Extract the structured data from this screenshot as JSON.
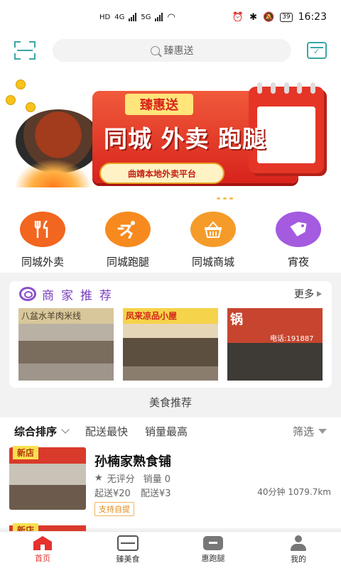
{
  "status_bar": {
    "hd_labels": [
      "HD",
      "HD"
    ],
    "network_labels": [
      "4G",
      "5G"
    ],
    "battery": "39",
    "time": "16:23"
  },
  "header": {
    "search_placeholder": "臻惠送",
    "scan_icon": "scan-icon",
    "calendar_icon": "calendar-check-icon",
    "accent_color": "#3aa6a6"
  },
  "banner": {
    "tag": "臻惠送",
    "title": "同城 外卖 跑腿",
    "subtitle": "曲靖本地外卖平台"
  },
  "categories": [
    {
      "label": "同城外卖",
      "icon": "fork-knife-icon",
      "color": "#f2661f"
    },
    {
      "label": "同城跑腿",
      "icon": "runner-icon",
      "color": "#f78a1f"
    },
    {
      "label": "同城商城",
      "icon": "basket-icon",
      "color": "#f59b2a"
    },
    {
      "label": "宵夜",
      "icon": "tag-icon",
      "color": "#a45be0"
    }
  ],
  "merchants": {
    "title": "商家推荐",
    "more": "更多",
    "shops": [
      {
        "sign": "八盆水羊肉米线",
        "sign_color": "#d8c79a"
      },
      {
        "sign": "凤来凉品小屋",
        "sign_color": "#f5d34a"
      },
      {
        "sign": "锅",
        "sign_color": "#c7452f",
        "phone": "电话:191887"
      }
    ]
  },
  "section_label": "美食推荐",
  "sort_bar": {
    "active": "综合排序",
    "options": [
      "配送最快",
      "销量最高"
    ],
    "filter": "筛选"
  },
  "stores": [
    {
      "badge": "新店",
      "name": "孙楠家熟食铺",
      "rating": "无评分",
      "sales": "销量 0",
      "min_order": "起送¥20",
      "delivery_fee": "配送¥3",
      "distance": "40分钟 1079.7km",
      "tag": "支持自提"
    },
    {
      "badge": "新店"
    }
  ],
  "bottom_nav": [
    {
      "label": "首页",
      "icon": "home-icon",
      "active": true
    },
    {
      "label": "臻美食",
      "icon": "food-box-icon",
      "active": false
    },
    {
      "label": "惠跑腿",
      "icon": "delivery-icon",
      "active": false
    },
    {
      "label": "我的",
      "icon": "user-icon",
      "active": false
    }
  ],
  "colors": {
    "primary_red": "#e5322d",
    "teal": "#3aa6a6",
    "purple": "#7a3fc0"
  }
}
